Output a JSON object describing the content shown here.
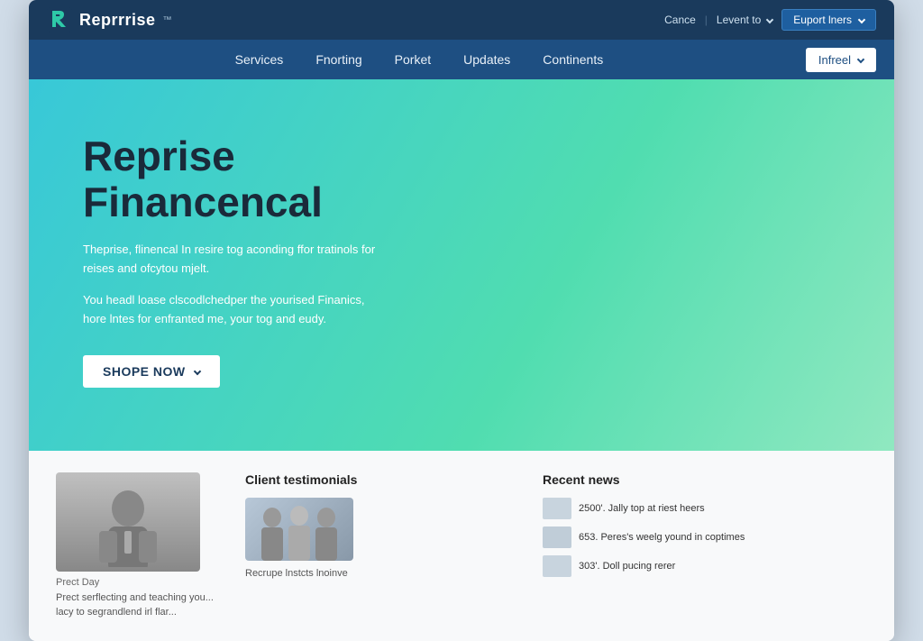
{
  "browser": {
    "frame_bg": "#d0dce8"
  },
  "topbar": {
    "logo_text": "Reprrrise",
    "logo_tm": "™",
    "cancel_link": "Cance",
    "levent_label": "Levent to",
    "export_label": "Euport lners"
  },
  "navbar": {
    "items": [
      {
        "label": "Services",
        "id": "services"
      },
      {
        "label": "Fnorting",
        "id": "fnorting"
      },
      {
        "label": "Porket",
        "id": "porket"
      },
      {
        "label": "Updates",
        "id": "updates"
      },
      {
        "label": "Continents",
        "id": "continents"
      }
    ],
    "cta_label": "Infreel"
  },
  "hero": {
    "title_line1": "Reprise",
    "title_line2": "Financencal",
    "desc1": "Theprise, flinencal In resire tog aconding ffor tratinols for reises and ofcytou mjelt.",
    "desc2": "You headl loase clscodlchedper the yourised Finanics, hore lntes for enfranted me, your tog and eudy.",
    "cta_label": "SHOPE NOW"
  },
  "bottom": {
    "person_label": "Prect Day",
    "person_text": "Prect serflecting and teaching you... lacy to segrandlend irl flar...",
    "testimonials_title": "Client testimonials",
    "testimonials_bottom": "Recrupe lnstcts lnoinve",
    "recent_news_title": "Recent news",
    "news_items": [
      {
        "thumb_color": "#c8d4de",
        "text": "2500'. Jally top at riest heers"
      },
      {
        "thumb_color": "#c8d4de",
        "text": "653. Peres's weelg yound in coptimes"
      },
      {
        "thumb_color": "#c8d4de",
        "text": "303'. Doll pucing rerer"
      }
    ]
  }
}
